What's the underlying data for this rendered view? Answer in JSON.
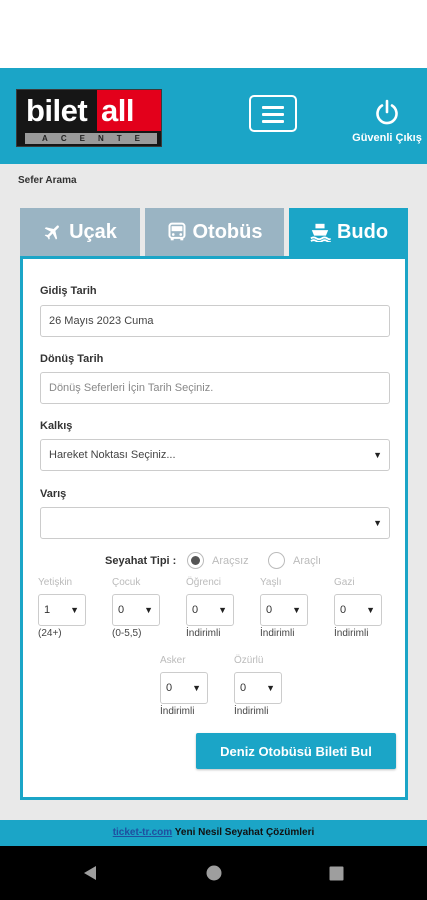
{
  "header": {
    "logo": {
      "bilet": "bilet",
      "all": "all",
      "agent": "ACENTE"
    },
    "logout_label": "Güvenli Çıkış"
  },
  "page": {
    "title": "Sefer Arama"
  },
  "tabs": [
    {
      "label": "Uçak",
      "icon": "plane-icon",
      "active": false
    },
    {
      "label": "Otobüs",
      "icon": "bus-icon",
      "active": false
    },
    {
      "label": "Budo",
      "icon": "ship-icon",
      "active": true
    }
  ],
  "form": {
    "departure_date": {
      "label": "Gidiş Tarih",
      "value": "26 Mayıs 2023 Cuma"
    },
    "return_date": {
      "label": "Dönüş Tarih",
      "placeholder": "Dönüş Seferleri İçin Tarih Seçiniz."
    },
    "origin": {
      "label": "Kalkış",
      "value": "Hareket Noktası Seçiniz..."
    },
    "destination": {
      "label": "Varış",
      "value": ""
    },
    "trip_type": {
      "label": "Seyahat Tipi :",
      "options": [
        {
          "label": "Araçsız",
          "checked": true
        },
        {
          "label": "Araçlı",
          "checked": false
        }
      ]
    },
    "passengers": [
      {
        "label": "Yetişkin",
        "value": "1",
        "note": "(24+)"
      },
      {
        "label": "Çocuk",
        "value": "0",
        "note": "(0-5,5)"
      },
      {
        "label": "Öğrenci",
        "value": "0",
        "note": "İndirimli"
      },
      {
        "label": "Yaşlı",
        "value": "0",
        "note": "İndirimli"
      },
      {
        "label": "Gazi",
        "value": "0",
        "note": "İndirimli"
      },
      {
        "label": "Asker",
        "value": "0",
        "note": "İndirimli"
      },
      {
        "label": "Özürlü",
        "value": "0",
        "note": "İndirimli"
      }
    ],
    "search_button": "Deniz Otobüsü Bileti Bul"
  },
  "footer": {
    "link": "ticket-tr.com",
    "text": "Yeni Nesil Seyahat Çözümleri"
  },
  "colors": {
    "primary": "#1ba5c7",
    "tab_inactive": "#9ab4c3",
    "logo_red": "#e3001b",
    "logo_black": "#161616"
  }
}
